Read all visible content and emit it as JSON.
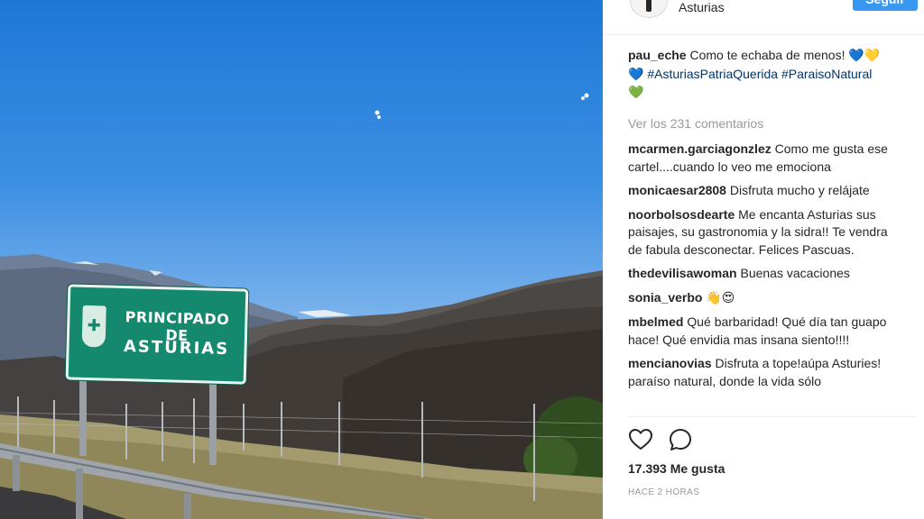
{
  "post": {
    "location": "Asturias",
    "follow_label": "Seguir",
    "sign": {
      "line1": "PRINCIPADO DE",
      "line2": "ASTURIAS"
    },
    "caption": {
      "user": "pau_eche",
      "text": "Como te echaba de menos!",
      "hashtags": "#AsturiasPatriaQuerida #ParaisoNatural",
      "emoji_line1": "💙💛",
      "emoji_line2": "💙",
      "emoji_line3": "💚"
    },
    "view_all_comments": "Ver los 231 comentarios",
    "comments": [
      {
        "user": "mcarmen.garciagonzlez",
        "text": "Como me gusta ese cartel....cuando lo veo me emociona"
      },
      {
        "user": "monicaesar2808",
        "text": "Disfruta mucho y relájate"
      },
      {
        "user": "noorbolsosdearte",
        "text": "Me encanta Asturias sus paisajes, su gastronomia y la sidra!! Te vendra de fabula desconectar. Felices Pascuas."
      },
      {
        "user": "thedevilisawoman",
        "text": "Buenas vacaciones"
      },
      {
        "user": "sonia_verbo",
        "text": "👋😍"
      },
      {
        "user": "mbelmed",
        "text": "Qué barbaridad! Qué día tan guapo hace! Qué envidia mas insana siento!!!!"
      },
      {
        "user": "mencianovias",
        "text": "Disfruta a tope!aúpa Asturies! paraíso natural, donde la vida sólo"
      }
    ],
    "likes": "17.393 Me gusta",
    "time_ago": "HACE 2 HORAS"
  },
  "icons": [
    "heart-icon",
    "comment-icon",
    "avatar"
  ],
  "colors": {
    "follow_button": "#3897f0",
    "hashtag": "#003569",
    "muted": "#999999",
    "sign_green": "#15896e"
  }
}
